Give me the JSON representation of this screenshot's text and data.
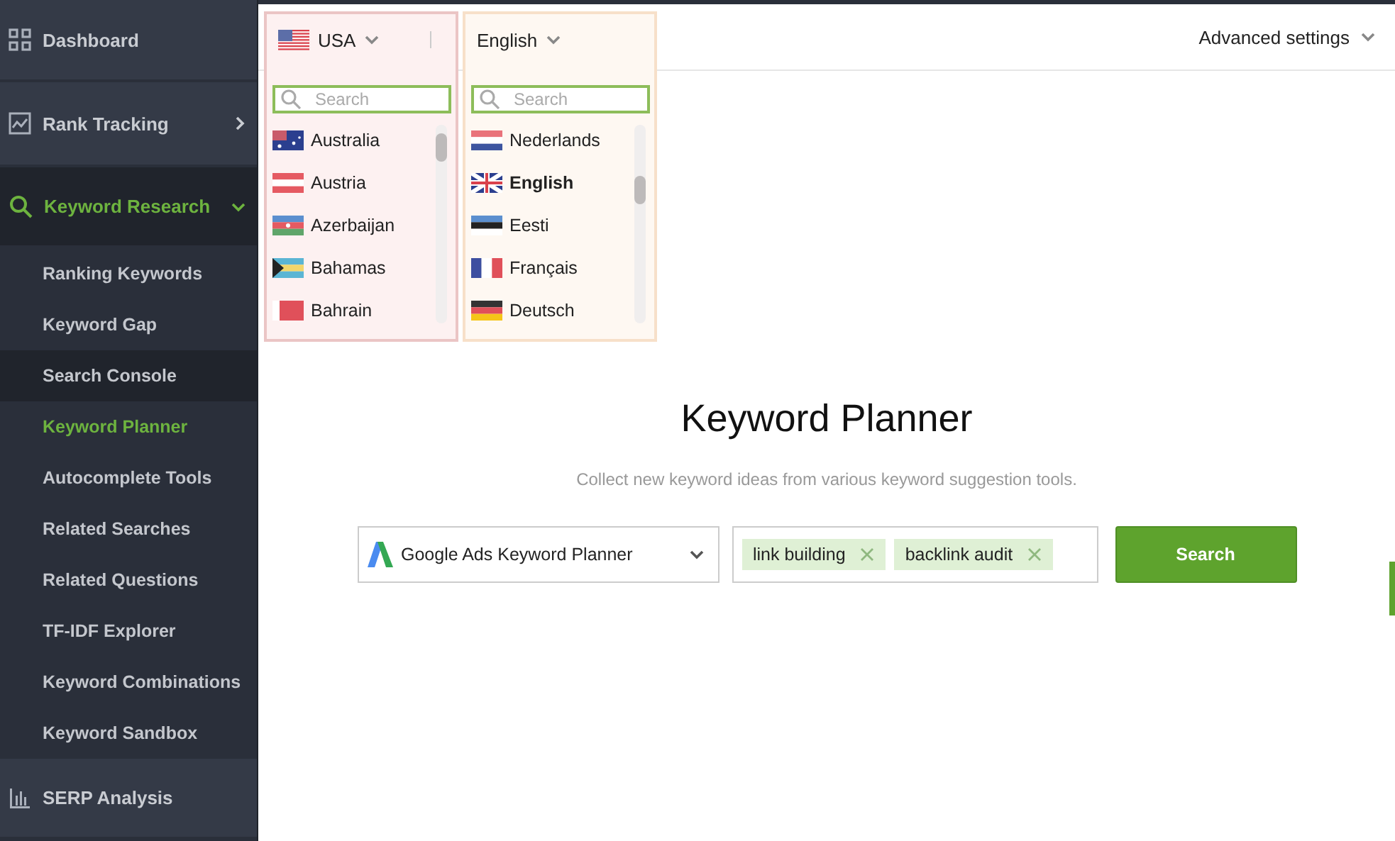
{
  "sidebar": {
    "items": [
      {
        "label": "Dashboard",
        "kind": "link",
        "selected": false
      },
      {
        "label": "Rank Tracking",
        "kind": "group",
        "selected": false,
        "expanded": false
      },
      {
        "label": "Keyword Research",
        "kind": "group",
        "selected": true,
        "expanded": true,
        "children": [
          {
            "label": "Ranking Keywords",
            "selected": false,
            "hovered": false
          },
          {
            "label": "Keyword Gap",
            "selected": false,
            "hovered": false
          },
          {
            "label": "Search Console",
            "selected": false,
            "hovered": true
          },
          {
            "label": "Keyword Planner",
            "selected": true,
            "hovered": false
          },
          {
            "label": "Autocomplete Tools",
            "selected": false,
            "hovered": false
          },
          {
            "label": "Related Searches",
            "selected": false,
            "hovered": false
          },
          {
            "label": "Related Questions",
            "selected": false,
            "hovered": false
          },
          {
            "label": "TF-IDF Explorer",
            "selected": false,
            "hovered": false
          },
          {
            "label": "Keyword Combinations",
            "selected": false,
            "hovered": false
          },
          {
            "label": "Keyword Sandbox",
            "selected": false,
            "hovered": false
          }
        ]
      },
      {
        "label": "SERP Analysis",
        "kind": "link",
        "selected": false
      }
    ]
  },
  "country_dropdown": {
    "value": "USA",
    "search_placeholder": "Search",
    "options": [
      {
        "label": "Australia"
      },
      {
        "label": "Austria"
      },
      {
        "label": "Azerbaijan"
      },
      {
        "label": "Bahamas"
      },
      {
        "label": "Bahrain"
      }
    ]
  },
  "language_dropdown": {
    "value": "English",
    "search_placeholder": "Search",
    "options": [
      {
        "label": "Nederlands",
        "selected": false
      },
      {
        "label": "English",
        "selected": true
      },
      {
        "label": "Eesti",
        "selected": false
      },
      {
        "label": "Français",
        "selected": false
      },
      {
        "label": "Deutsch",
        "selected": false
      }
    ]
  },
  "advanced_settings": "Advanced settings",
  "title": "Keyword Planner",
  "subtitle": "Collect new keyword ideas from various keyword suggestion tools.",
  "source_select": {
    "value": "Google Ads Keyword Planner"
  },
  "keywords": [
    {
      "label": "link building"
    },
    {
      "label": "backlink audit"
    }
  ],
  "search_button": "Search"
}
